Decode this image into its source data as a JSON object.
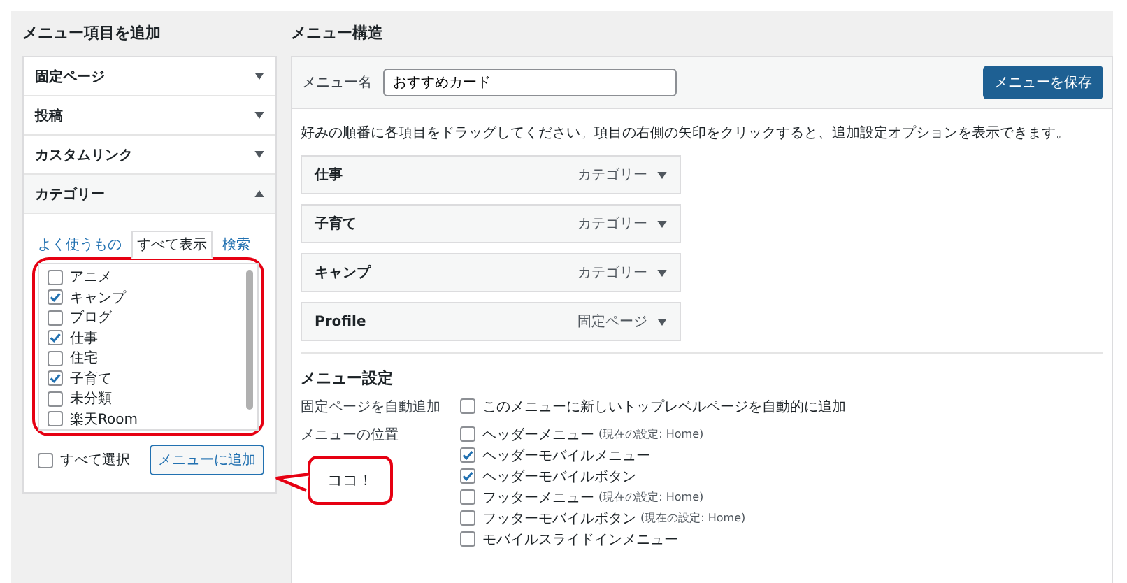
{
  "left": {
    "title": "メニュー項目を追加",
    "sections": [
      {
        "label": "固定ページ",
        "expanded": false
      },
      {
        "label": "投稿",
        "expanded": false
      },
      {
        "label": "カスタムリンク",
        "expanded": false
      },
      {
        "label": "カテゴリー",
        "expanded": true
      }
    ],
    "category_tabs": [
      {
        "label": "よく使うもの",
        "selected": false
      },
      {
        "label": "すべて表示",
        "selected": true
      },
      {
        "label": "検索",
        "selected": false
      }
    ],
    "categories": [
      {
        "label": "アニメ",
        "checked": false
      },
      {
        "label": "キャンプ",
        "checked": true
      },
      {
        "label": "ブログ",
        "checked": false
      },
      {
        "label": "仕事",
        "checked": true
      },
      {
        "label": "住宅",
        "checked": false
      },
      {
        "label": "子育て",
        "checked": true
      },
      {
        "label": "未分類",
        "checked": false
      },
      {
        "label": "楽天Room",
        "checked": false
      }
    ],
    "select_all": {
      "label": "すべて選択",
      "checked": false
    },
    "add_button": "メニューに追加"
  },
  "callout": {
    "text": "ココ！"
  },
  "right": {
    "title": "メニュー構造",
    "menu_name_label": "メニュー名",
    "menu_name_value": "おすすめカード",
    "save_button": "メニューを保存",
    "instructions": "好みの順番に各項目をドラッグしてください。項目の右側の矢印をクリックすると、追加設定オプションを表示できます。",
    "menu_items": [
      {
        "title": "仕事",
        "type": "カテゴリー"
      },
      {
        "title": "子育て",
        "type": "カテゴリー"
      },
      {
        "title": "キャンプ",
        "type": "カテゴリー"
      },
      {
        "title": "Profile",
        "type": "固定ページ"
      }
    ],
    "settings_title": "メニュー設定",
    "auto_add": {
      "label": "固定ページを自動追加",
      "option": "このメニューに新しいトップレベルページを自動的に追加",
      "checked": false
    },
    "locations": {
      "label": "メニューの位置",
      "options": [
        {
          "label": "ヘッダーメニュー",
          "note": "(現在の設定: Home)",
          "checked": false
        },
        {
          "label": "ヘッダーモバイルメニュー",
          "checked": true
        },
        {
          "label": "ヘッダーモバイルボタン",
          "checked": true
        },
        {
          "label": "フッターメニュー",
          "note": "(現在の設定: Home)",
          "checked": false
        },
        {
          "label": "フッターモバイルボタン",
          "note": "(現在の設定: Home)",
          "checked": false
        },
        {
          "label": "モバイルスライドインメニュー",
          "checked": false
        }
      ]
    }
  }
}
